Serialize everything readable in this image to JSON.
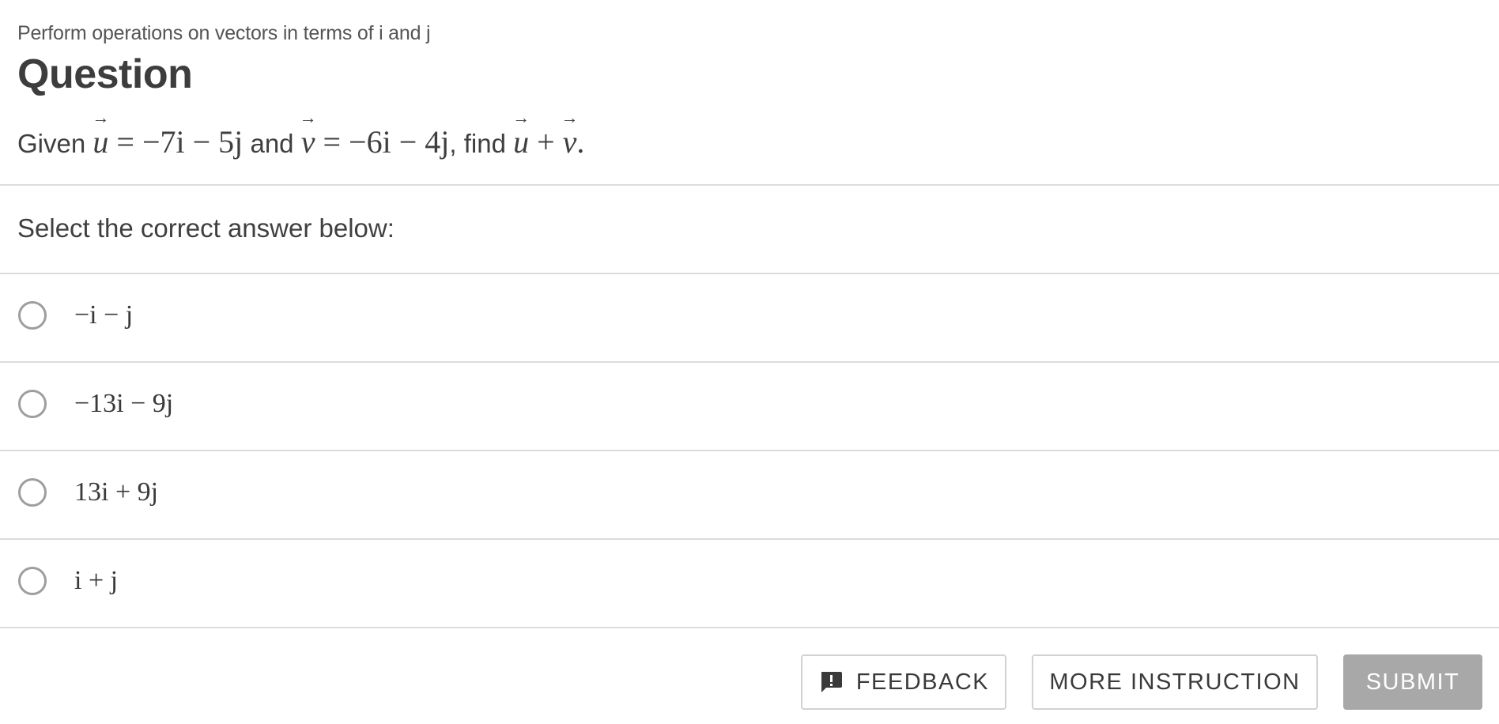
{
  "topic": "Perform operations on vectors in terms of i and j",
  "heading": "Question",
  "question": {
    "given_label": "Given",
    "and_label": "and",
    "find_label": ", find",
    "vec_u": "u",
    "vec_v": "v",
    "u_value": "= −7i − 5j",
    "v_value": "= −6i − 4j",
    "expression_op": "+",
    "end_punct": "."
  },
  "instruction": "Select the correct answer below:",
  "options": [
    {
      "label": "−i − j",
      "selected": false
    },
    {
      "label": "−13i − 9j",
      "selected": false
    },
    {
      "label": "13i + 9j",
      "selected": false
    },
    {
      "label": "i + j",
      "selected": false
    }
  ],
  "buttons": {
    "feedback": "FEEDBACK",
    "more_instruction": "MORE INSTRUCTION",
    "submit": "SUBMIT"
  },
  "icons": {
    "feedback": "feedback-icon"
  },
  "colors": {
    "text": "#3f3f3f",
    "divider": "#dcdcdc",
    "radio_border": "#9e9e9e",
    "submit_disabled": "#a8a8a8"
  }
}
